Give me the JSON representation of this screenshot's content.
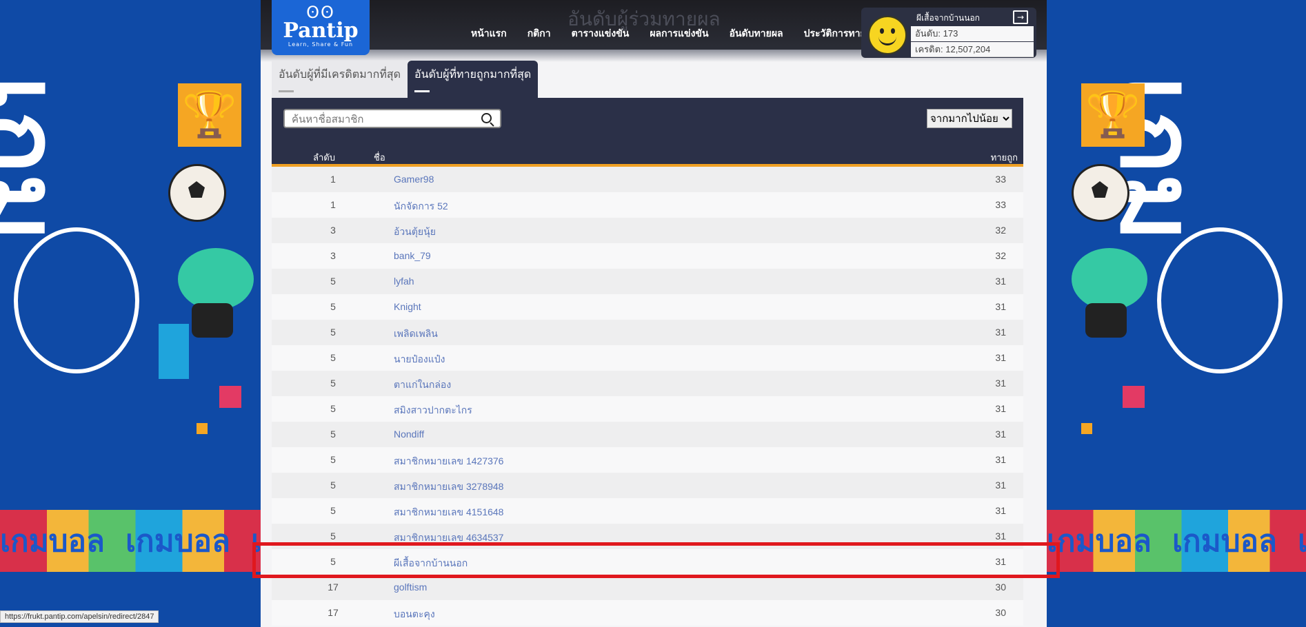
{
  "header": {
    "logo_word": "Pantip",
    "logo_tagline": "Learn, Share & Fun",
    "page_title": "อันดับผู้ร่วมทายผล",
    "nav": [
      "หน้าแรก",
      "กติกา",
      "ตารางแข่งขัน",
      "ผลการแข่งขัน",
      "อันดับทายผล",
      "ประวัติการทาย"
    ]
  },
  "user": {
    "name": "ผีเสื้อจากบ้านนอก",
    "rank": "อันดับ: 173",
    "credit": "เครดิต: 12,507,204"
  },
  "tabs": [
    {
      "label": "อันดับผู้ที่มีเครดิตมากที่สุด",
      "active": false
    },
    {
      "label": "อันดับผู้ที่ทายถูกมากที่สุด",
      "active": true
    }
  ],
  "search": {
    "placeholder": "ค้นหาชื่อสมาชิก"
  },
  "sort": {
    "selected": "จากมากไปน้อย"
  },
  "table": {
    "headers": {
      "rank": "ลำดับ",
      "name": "ชื่อ",
      "correct": "ทายถูก"
    },
    "rows": [
      {
        "rank": "1",
        "name": "Gamer98",
        "correct": "33"
      },
      {
        "rank": "1",
        "name": "นักจัดการ 52",
        "correct": "33"
      },
      {
        "rank": "3",
        "name": "อ้วนตุ้ยนุ้ย",
        "correct": "32"
      },
      {
        "rank": "3",
        "name": "bank_79",
        "correct": "32"
      },
      {
        "rank": "5",
        "name": "lyfah",
        "correct": "31"
      },
      {
        "rank": "5",
        "name": "Knight",
        "correct": "31"
      },
      {
        "rank": "5",
        "name": "เพลิดเพลิน",
        "correct": "31"
      },
      {
        "rank": "5",
        "name": "นายป๋องแป๋ง",
        "correct": "31"
      },
      {
        "rank": "5",
        "name": "ตาแก่ในกล่อง",
        "correct": "31"
      },
      {
        "rank": "5",
        "name": "สมิงสาวปากตะไกร",
        "correct": "31"
      },
      {
        "rank": "5",
        "name": "Nondiff",
        "correct": "31"
      },
      {
        "rank": "5",
        "name": "สมาชิกหมายเลข 1427376",
        "correct": "31"
      },
      {
        "rank": "5",
        "name": "สมาชิกหมายเลข 3278948",
        "correct": "31"
      },
      {
        "rank": "5",
        "name": "สมาชิกหมายเลข 4151648",
        "correct": "31"
      },
      {
        "rank": "5",
        "name": "สมาชิกหมายเลข 4634537",
        "correct": "31"
      },
      {
        "rank": "5",
        "name": "ผีเสื้อจากบ้านนอก",
        "correct": "31"
      },
      {
        "rank": "17",
        "name": "golftism",
        "correct": "30"
      },
      {
        "rank": "17",
        "name": "บอนตะคุง",
        "correct": "30"
      }
    ]
  },
  "banner": {
    "word": "เกมบอล",
    "brand": "PANTIP"
  },
  "status_url": "https://frukt.pantip.com/apelsin/redirect/2847",
  "colors": {
    "accent": "#f0a023",
    "panel": "#2b3048",
    "highlight": "#e0181e",
    "link": "#5a76bb"
  }
}
